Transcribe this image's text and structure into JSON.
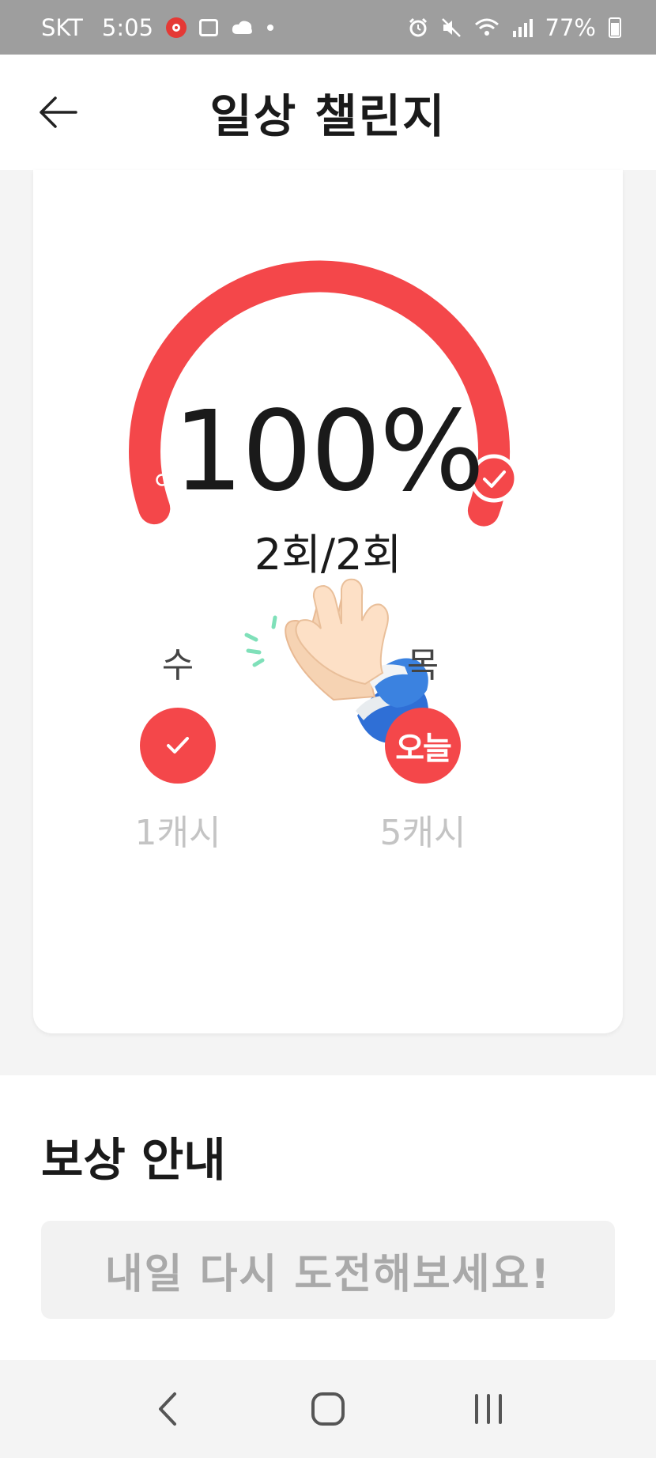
{
  "status_bar": {
    "carrier": "SKT",
    "time": "5:05",
    "battery": "77%",
    "icons": [
      "recorder-icon",
      "gallery-icon",
      "cloud-icon",
      "dot-icon",
      "alarm-icon",
      "mute-icon",
      "wifi-icon",
      "signal-icon",
      "battery-icon"
    ]
  },
  "header": {
    "title": "일상 챌린지",
    "back_icon": "back-arrow-icon"
  },
  "challenge": {
    "percent_text": "100%",
    "progress": 1.0,
    "count_text": "2회/2회",
    "accent_color": "#f4474a",
    "days": [
      {
        "label": "수",
        "status": "done",
        "reward": "1캐시"
      },
      {
        "label": "목",
        "status": "today",
        "badge": "오늘",
        "reward": "5캐시"
      }
    ]
  },
  "rewards": {
    "title": "보상 안내",
    "button_label": "내일 다시 도전해보세요!"
  },
  "nav_bar": {
    "buttons": [
      "back-nav-icon",
      "home-nav-icon",
      "recents-nav-icon"
    ]
  }
}
